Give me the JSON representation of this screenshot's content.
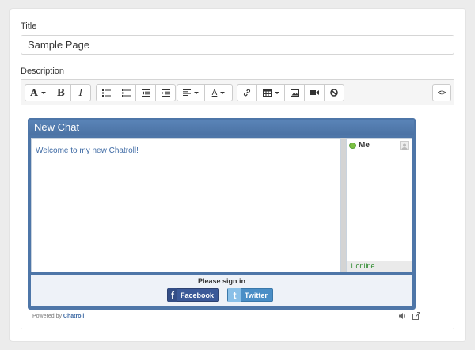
{
  "form": {
    "title_label": "Title",
    "title_value": "Sample Page",
    "description_label": "Description"
  },
  "toolbar": {
    "font_glyph": "A",
    "bold_glyph": "B",
    "italic_glyph": "I",
    "color_glyph": "A",
    "code_glyph": "<>"
  },
  "chat": {
    "title": "New Chat",
    "welcome": "Welcome to my new Chatroll!",
    "user": "Me",
    "online": "1 online",
    "sign_in": "Please sign in",
    "facebook": "Facebook",
    "twitter": "Twitter",
    "powered_by": "Powered by",
    "brand": "Chatroll"
  },
  "colors": {
    "chat_frame": "#4e76a8",
    "online_green": "#2e8b2e",
    "facebook": "#3b5998",
    "twitter": "#4a8ec6"
  }
}
